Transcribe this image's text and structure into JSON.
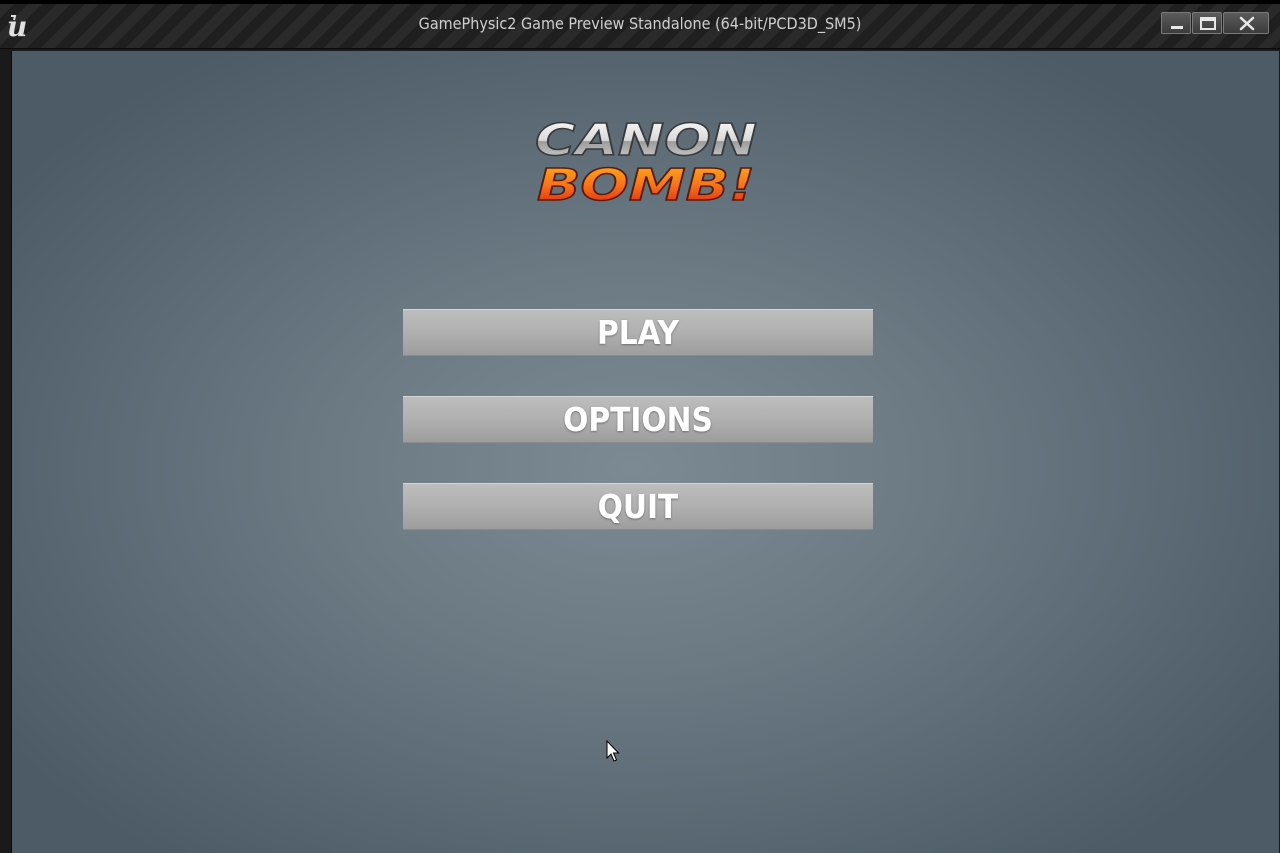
{
  "window": {
    "title": "GamePhysic2 Game Preview Standalone (64-bit/PCD3D_SM5)",
    "controls": {
      "minimize_icon": "minimize-icon",
      "maximize_icon": "maximize-icon",
      "close_icon": "close-icon"
    },
    "engine_logo": "unreal-engine-logo"
  },
  "game": {
    "logo": {
      "line1": "CANON",
      "line2": "BOMB!"
    },
    "menu": {
      "play_label": "PLAY",
      "options_label": "OPTIONS",
      "quit_label": "QUIT"
    }
  },
  "colors": {
    "background": "#6c7a84",
    "button": "#b0b0b0",
    "button_text": "#ffffff",
    "logo_top": "#e6e6e6",
    "logo_bottom": "#f36b12"
  }
}
